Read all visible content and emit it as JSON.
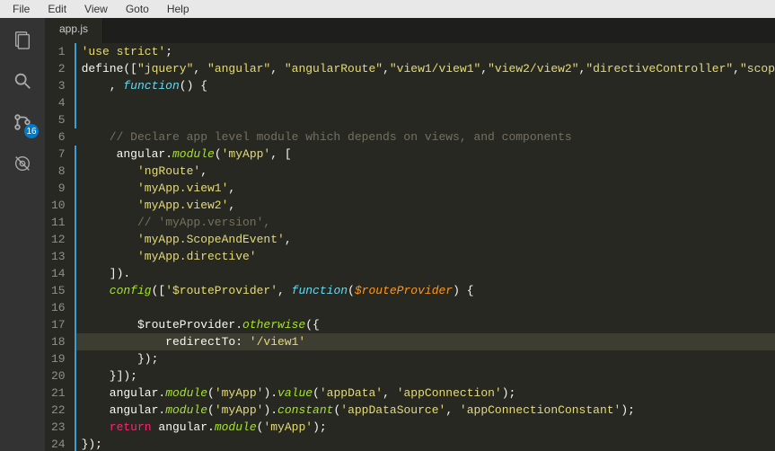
{
  "menubar": {
    "items": [
      "File",
      "Edit",
      "View",
      "Goto",
      "Help"
    ]
  },
  "activitybar": {
    "git_badge": 16
  },
  "tab": {
    "title": "app.js"
  },
  "code": {
    "lines": [
      {
        "num": 1,
        "modified": true,
        "tokens": [
          {
            "t": "'use strict'",
            "c": "tok-str"
          },
          {
            "t": ";",
            "c": "tok-punct"
          }
        ]
      },
      {
        "num": 2,
        "modified": true,
        "tokens": [
          {
            "t": "define",
            "c": "tok-var"
          },
          {
            "t": "([",
            "c": "tok-punct"
          },
          {
            "t": "\"jquery\"",
            "c": "tok-str"
          },
          {
            "t": ", ",
            "c": "tok-punct"
          },
          {
            "t": "\"angular\"",
            "c": "tok-str"
          },
          {
            "t": ", ",
            "c": "tok-punct"
          },
          {
            "t": "\"angularRoute\"",
            "c": "tok-str"
          },
          {
            "t": ",",
            "c": "tok-punct"
          },
          {
            "t": "\"view1/view1\"",
            "c": "tok-str"
          },
          {
            "t": ",",
            "c": "tok-punct"
          },
          {
            "t": "\"view2/view2\"",
            "c": "tok-str"
          },
          {
            "t": ",",
            "c": "tok-punct"
          },
          {
            "t": "\"directiveController\"",
            "c": "tok-str"
          },
          {
            "t": ",",
            "c": "tok-punct"
          },
          {
            "t": "\"scop",
            "c": "tok-str"
          }
        ]
      },
      {
        "num": 3,
        "modified": true,
        "tokens": [
          {
            "t": "    , ",
            "c": "tok-punct"
          },
          {
            "t": "function",
            "c": "tok-func"
          },
          {
            "t": "() {",
            "c": "tok-punct"
          }
        ]
      },
      {
        "num": 4,
        "modified": true,
        "tokens": []
      },
      {
        "num": 5,
        "modified": true,
        "tokens": []
      },
      {
        "num": 6,
        "modified": false,
        "tokens": [
          {
            "t": "    ",
            "c": ""
          },
          {
            "t": "// Declare app level module which depends on views, and components",
            "c": "tok-comment"
          }
        ]
      },
      {
        "num": 7,
        "modified": true,
        "tokens": [
          {
            "t": "     ",
            "c": ""
          },
          {
            "t": "angular",
            "c": "tok-var"
          },
          {
            "t": ".",
            "c": "tok-punct"
          },
          {
            "t": "module",
            "c": "tok-fn"
          },
          {
            "t": "(",
            "c": "tok-punct"
          },
          {
            "t": "'myApp'",
            "c": "tok-str"
          },
          {
            "t": ", [",
            "c": "tok-punct"
          }
        ]
      },
      {
        "num": 8,
        "modified": true,
        "tokens": [
          {
            "t": "        ",
            "c": ""
          },
          {
            "t": "'ngRoute'",
            "c": "tok-str"
          },
          {
            "t": ",",
            "c": "tok-punct"
          }
        ]
      },
      {
        "num": 9,
        "modified": true,
        "tokens": [
          {
            "t": "        ",
            "c": ""
          },
          {
            "t": "'myApp.view1'",
            "c": "tok-str"
          },
          {
            "t": ",",
            "c": "tok-punct"
          }
        ]
      },
      {
        "num": 10,
        "modified": true,
        "tokens": [
          {
            "t": "        ",
            "c": ""
          },
          {
            "t": "'myApp.view2'",
            "c": "tok-str"
          },
          {
            "t": ",",
            "c": "tok-punct"
          }
        ]
      },
      {
        "num": 11,
        "modified": true,
        "tokens": [
          {
            "t": "        ",
            "c": ""
          },
          {
            "t": "// 'myApp.version',",
            "c": "tok-comment"
          }
        ]
      },
      {
        "num": 12,
        "modified": true,
        "tokens": [
          {
            "t": "        ",
            "c": ""
          },
          {
            "t": "'myApp.ScopeAndEvent'",
            "c": "tok-str"
          },
          {
            "t": ",",
            "c": "tok-punct"
          }
        ]
      },
      {
        "num": 13,
        "modified": true,
        "tokens": [
          {
            "t": "        ",
            "c": ""
          },
          {
            "t": "'myApp.directive'",
            "c": "tok-str"
          }
        ]
      },
      {
        "num": 14,
        "modified": true,
        "tokens": [
          {
            "t": "    ]).",
            "c": "tok-punct"
          }
        ]
      },
      {
        "num": 15,
        "modified": true,
        "tokens": [
          {
            "t": "    ",
            "c": ""
          },
          {
            "t": "config",
            "c": "tok-fn"
          },
          {
            "t": "([",
            "c": "tok-punct"
          },
          {
            "t": "'$routeProvider'",
            "c": "tok-str"
          },
          {
            "t": ", ",
            "c": "tok-punct"
          },
          {
            "t": "function",
            "c": "tok-func"
          },
          {
            "t": "(",
            "c": "tok-punct"
          },
          {
            "t": "$routeProvider",
            "c": "tok-param"
          },
          {
            "t": ") {",
            "c": "tok-punct"
          }
        ]
      },
      {
        "num": 16,
        "modified": true,
        "tokens": []
      },
      {
        "num": 17,
        "modified": true,
        "tokens": [
          {
            "t": "        ",
            "c": ""
          },
          {
            "t": "$routeProvider",
            "c": "tok-var"
          },
          {
            "t": ".",
            "c": "tok-punct"
          },
          {
            "t": "otherwise",
            "c": "tok-fn"
          },
          {
            "t": "({",
            "c": "tok-punct"
          }
        ]
      },
      {
        "num": 18,
        "modified": true,
        "highlighted": true,
        "tokens": [
          {
            "t": "            redirectTo: ",
            "c": "tok-var"
          },
          {
            "t": "'/view1'",
            "c": "tok-str"
          }
        ]
      },
      {
        "num": 19,
        "modified": true,
        "tokens": [
          {
            "t": "        });",
            "c": "tok-punct"
          }
        ]
      },
      {
        "num": 20,
        "modified": true,
        "tokens": [
          {
            "t": "    }]);",
            "c": "tok-punct"
          }
        ]
      },
      {
        "num": 21,
        "modified": true,
        "tokens": [
          {
            "t": "    ",
            "c": ""
          },
          {
            "t": "angular",
            "c": "tok-var"
          },
          {
            "t": ".",
            "c": "tok-punct"
          },
          {
            "t": "module",
            "c": "tok-fn"
          },
          {
            "t": "(",
            "c": "tok-punct"
          },
          {
            "t": "'myApp'",
            "c": "tok-str"
          },
          {
            "t": ").",
            "c": "tok-punct"
          },
          {
            "t": "value",
            "c": "tok-fn"
          },
          {
            "t": "(",
            "c": "tok-punct"
          },
          {
            "t": "'appData'",
            "c": "tok-str"
          },
          {
            "t": ", ",
            "c": "tok-punct"
          },
          {
            "t": "'appConnection'",
            "c": "tok-str"
          },
          {
            "t": ");",
            "c": "tok-punct"
          }
        ]
      },
      {
        "num": 22,
        "modified": true,
        "tokens": [
          {
            "t": "    ",
            "c": ""
          },
          {
            "t": "angular",
            "c": "tok-var"
          },
          {
            "t": ".",
            "c": "tok-punct"
          },
          {
            "t": "module",
            "c": "tok-fn"
          },
          {
            "t": "(",
            "c": "tok-punct"
          },
          {
            "t": "'myApp'",
            "c": "tok-str"
          },
          {
            "t": ").",
            "c": "tok-punct"
          },
          {
            "t": "constant",
            "c": "tok-fn"
          },
          {
            "t": "(",
            "c": "tok-punct"
          },
          {
            "t": "'appDataSource'",
            "c": "tok-str"
          },
          {
            "t": ", ",
            "c": "tok-punct"
          },
          {
            "t": "'appConnectionConstant'",
            "c": "tok-str"
          },
          {
            "t": ");",
            "c": "tok-punct"
          }
        ]
      },
      {
        "num": 23,
        "modified": true,
        "tokens": [
          {
            "t": "    ",
            "c": ""
          },
          {
            "t": "return",
            "c": "tok-kw"
          },
          {
            "t": " ",
            "c": ""
          },
          {
            "t": "angular",
            "c": "tok-var"
          },
          {
            "t": ".",
            "c": "tok-punct"
          },
          {
            "t": "module",
            "c": "tok-fn"
          },
          {
            "t": "(",
            "c": "tok-punct"
          },
          {
            "t": "'myApp'",
            "c": "tok-str"
          },
          {
            "t": ");",
            "c": "tok-punct"
          }
        ]
      },
      {
        "num": 24,
        "modified": true,
        "tokens": [
          {
            "t": "});",
            "c": "tok-punct"
          }
        ]
      }
    ]
  }
}
